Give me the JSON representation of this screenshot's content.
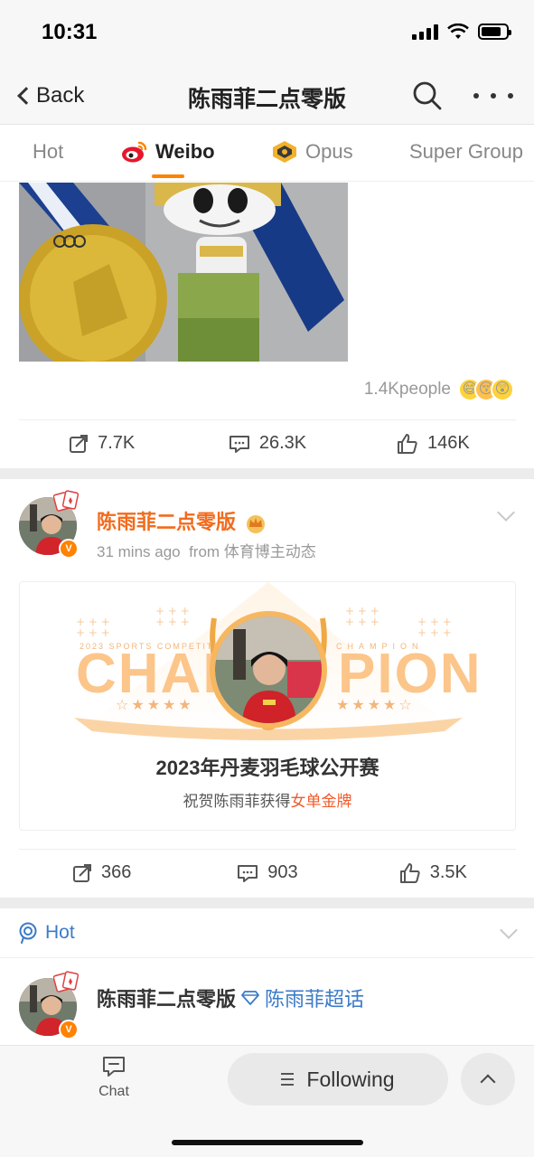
{
  "status_bar": {
    "time": "10:31"
  },
  "header": {
    "back_label": "Back",
    "title": "陈雨菲二点零版"
  },
  "tabs": [
    {
      "label": "Hot"
    },
    {
      "label": "Weibo"
    },
    {
      "label": "Opus"
    },
    {
      "label": "Super Group"
    }
  ],
  "post1": {
    "reactions_count": "1.4Kpeople",
    "reposts": "7.7K",
    "comments": "26.3K",
    "likes": "146K"
  },
  "post2": {
    "author": "陈雨菲二点零版",
    "time": "31 mins ago",
    "source": "from 体育博主动态",
    "card": {
      "sub_left": "2023 SPORTS COMPETITION",
      "sub_right": "CHAMPION",
      "word_left": "CHAM",
      "word_right": "PION",
      "stars": "☆★★★★",
      "stars_right": "★★★★☆",
      "title": "2023年丹麦羽毛球公开赛",
      "caption_prefix": "祝贺陈雨菲获得",
      "caption_highlight": "女单金牌"
    },
    "reposts": "366",
    "comments": "903",
    "likes": "3.5K"
  },
  "hot_section": {
    "label": "Hot"
  },
  "post3": {
    "author": "陈雨菲二点零版",
    "topic": "陈雨菲超话"
  },
  "bottom_bar": {
    "chat_label": "Chat",
    "following_label": "Following"
  },
  "colors": {
    "brand_orange": "#ff8200",
    "author_orange": "#f26b1d",
    "link_blue": "#3b7bc8",
    "highlight_red": "#f15a2b"
  }
}
